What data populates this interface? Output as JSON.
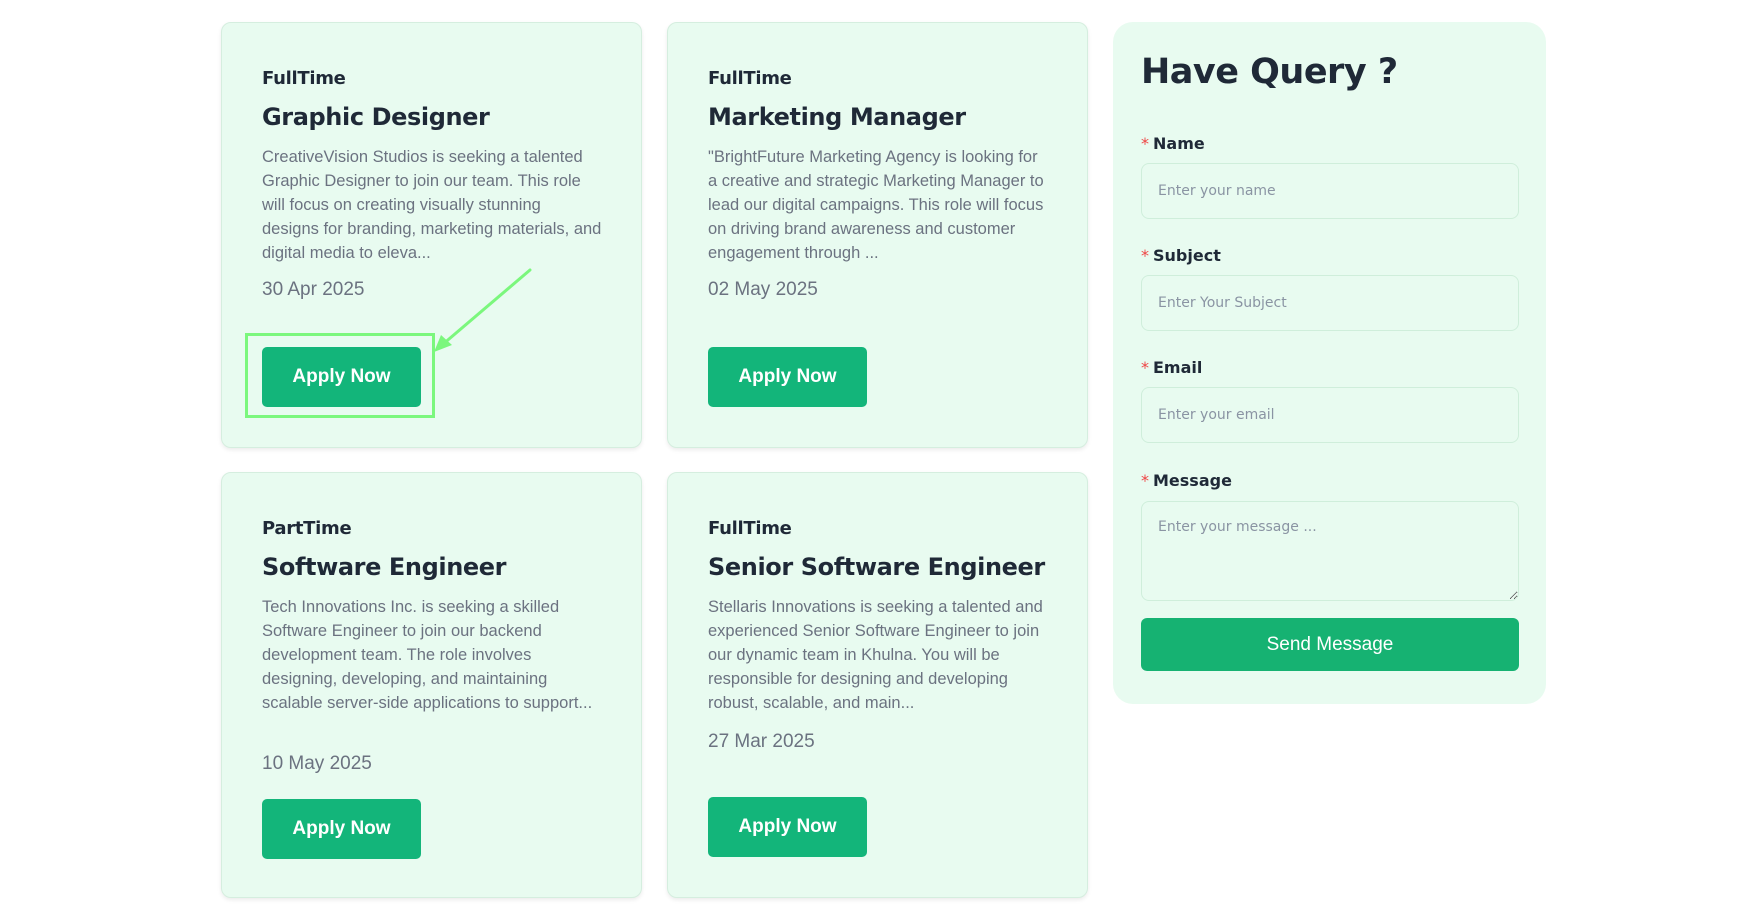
{
  "jobs": [
    {
      "type": "FullTime",
      "title": "Graphic Designer",
      "description": "CreativeVision Studios is seeking a talented Graphic Designer to join our team. This role will focus on creating visually stunning designs for branding, marketing materials, and digital media to eleva...",
      "date": "30 Apr 2025",
      "apply_label": "Apply Now"
    },
    {
      "type": "FullTime",
      "title": "Marketing Manager",
      "description": "\"BrightFuture Marketing Agency is looking for a creative and strategic Marketing Manager to lead our digital campaigns. This role will focus on driving brand awareness and customer engagement through ...",
      "date": "02 May 2025",
      "apply_label": "Apply Now"
    },
    {
      "type": "PartTime",
      "title": "Software Engineer",
      "description": "Tech Innovations Inc. is seeking a skilled Software Engineer to join our backend development team. The role involves designing, developing, and maintaining scalable server-side applications to support...",
      "date": "10 May 2025",
      "apply_label": "Apply Now"
    },
    {
      "type": "FullTime",
      "title": "Senior Software Engineer",
      "description": "Stellaris Innovations is seeking a talented and experienced Senior Software Engineer to join our dynamic team in Khulna. You will be responsible for designing and developing robust, scalable, and main...",
      "date": "27 Mar 2025",
      "apply_label": "Apply Now"
    }
  ],
  "query_form": {
    "title": "Have Query ?",
    "required_mark": "*",
    "fields": {
      "name": {
        "label": "Name",
        "placeholder": "Enter your name"
      },
      "subject": {
        "label": "Subject",
        "placeholder": "Enter Your Subject"
      },
      "email": {
        "label": "Email",
        "placeholder": "Enter your email"
      },
      "message": {
        "label": "Message",
        "placeholder": "Enter your message ..."
      }
    },
    "submit_label": "Send Message"
  },
  "colors": {
    "card_bg": "#e8fbf0",
    "button": "#13b57a",
    "send_button": "#16b272",
    "annotation": "#7bf77d",
    "required": "#ef4444"
  }
}
